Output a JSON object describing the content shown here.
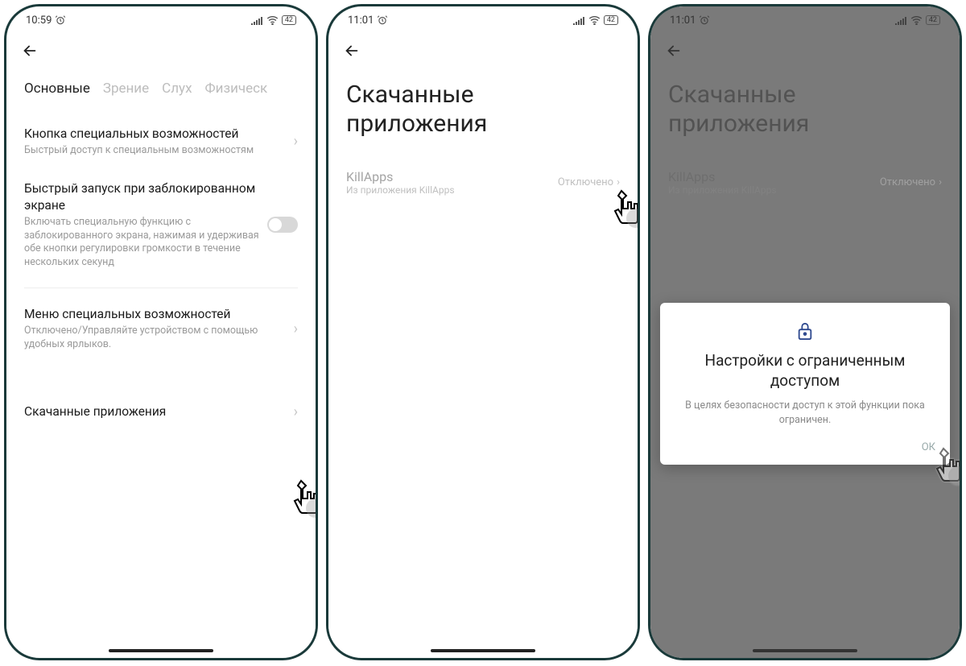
{
  "status": {
    "battery": "42"
  },
  "screens": [
    {
      "time": "10:59",
      "tabs": [
        "Основные",
        "Зрение",
        "Слух",
        "Физическ"
      ],
      "active_tab": 0,
      "items": {
        "accessibility_button": {
          "title": "Кнопка специальных возможностей",
          "sub": "Быстрый доступ к специальным возможностям"
        },
        "quick_launch": {
          "title": "Быстрый запуск при заблокированном экране",
          "sub": "Включать специальную функцию с заблокированного экрана, нажимая и удерживая обе кнопки регулировки громкости в течение нескольких секунд"
        },
        "accessibility_menu": {
          "title": "Меню специальных возможностей",
          "sub": "Отключено/Управляйте устройством с помощью удобных ярлыков."
        },
        "downloaded": {
          "title": "Скачанные приложения"
        }
      }
    },
    {
      "time": "11:01",
      "page_title": "Скачанные приложения",
      "app": {
        "name": "KillApps",
        "sub": "Из приложения KillApps",
        "status": "Отключено"
      }
    },
    {
      "time": "11:01",
      "page_title": "Скачанные приложения",
      "app": {
        "name": "KillApps",
        "sub": "Из приложения KillApps",
        "status": "Отключено"
      },
      "modal": {
        "title": "Настройки с ограниченным доступом",
        "body": "В целях безопасности доступ к этой функции пока ограничен.",
        "ok": "ОК"
      }
    }
  ]
}
